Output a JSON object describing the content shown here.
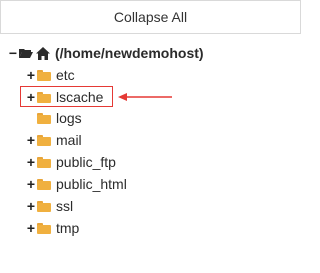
{
  "toolbar": {
    "collapse_all_label": "Collapse All"
  },
  "tree": {
    "root": {
      "toggle": "−",
      "label": "(/home/newdemohost)",
      "icon": "home-icon"
    },
    "items": [
      {
        "toggle": "+",
        "label": "etc",
        "icon": "folder-icon"
      },
      {
        "toggle": "+",
        "label": "lscache",
        "icon": "folder-icon"
      },
      {
        "toggle": "",
        "label": "logs",
        "icon": "folder-icon"
      },
      {
        "toggle": "+",
        "label": "mail",
        "icon": "folder-icon"
      },
      {
        "toggle": "+",
        "label": "public_ftp",
        "icon": "folder-icon"
      },
      {
        "toggle": "+",
        "label": "public_html",
        "icon": "folder-icon"
      },
      {
        "toggle": "+",
        "label": "ssl",
        "icon": "folder-icon"
      },
      {
        "toggle": "+",
        "label": "tmp",
        "icon": "folder-icon"
      }
    ]
  },
  "annotation": {
    "highlight_color": "#e53935",
    "target_item": "lscache"
  },
  "colors": {
    "folder": "#f0b03f",
    "text": "#2b2b2b",
    "border": "#d9d9d9"
  }
}
